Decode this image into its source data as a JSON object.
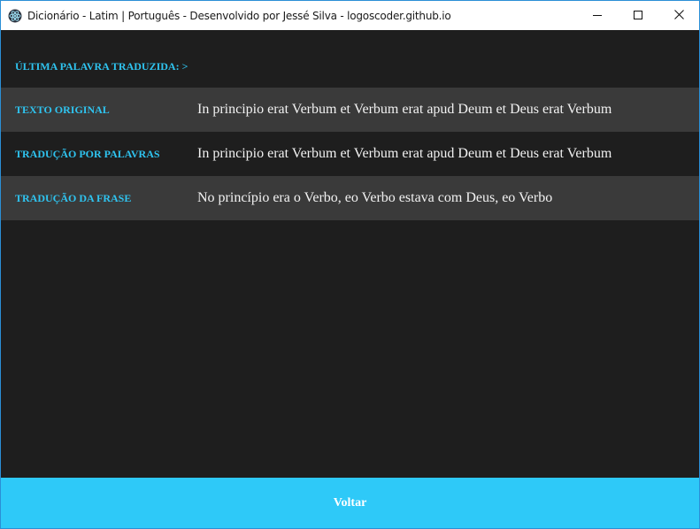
{
  "window": {
    "title": "Dicionário - Latim | Português - Desenvolvido por Jessé Silva - logoscoder.github.io",
    "app_icon": "electron-atom-icon",
    "controls": {
      "minimize_icon": "minimize-icon",
      "maximize_icon": "maximize-icon",
      "close_icon": "close-icon"
    }
  },
  "main": {
    "last_word_label": "ÚLTIMA PALAVRA TRADUZIDA: >",
    "rows": [
      {
        "label": "TEXTO ORIGINAL",
        "value": "In principio erat Verbum et Verbum erat apud Deum et Deus erat Verbum"
      },
      {
        "label": "TRADUÇÃO POR PALAVRAS",
        "value": "In principio erat Verbum et Verbum erat apud Deum et Deus erat Verbum"
      },
      {
        "label": "TRADUÇÃO DA FRASE",
        "value": "No princípio era o Verbo, eo Verbo estava com Deus, eo Verbo"
      }
    ]
  },
  "footer": {
    "back_label": "Voltar"
  },
  "colors": {
    "accent": "#2fc4f0",
    "button": "#2ec9f8",
    "background": "#1e1e1e",
    "row_shade": "#3a3a3a",
    "text": "#f2f2f2"
  }
}
